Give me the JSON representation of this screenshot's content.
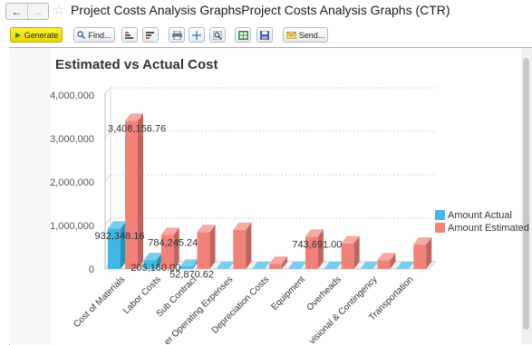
{
  "window": {
    "title": "Project Costs Analysis GraphsProject Costs Analysis Graphs (CTR)"
  },
  "toolbar": {
    "generate_label": "Generate",
    "find_label": "Find...",
    "send_label": "Send..."
  },
  "chart_data": {
    "type": "bar",
    "title": "Estimated vs Actual Cost",
    "categories": [
      "Cost of Materials",
      "Labor Costs",
      "Sub Contract",
      "er Operating Expenses",
      "Depreciation Costs",
      "Equipment",
      "Overheads",
      "visional & Contingency",
      "Transportation"
    ],
    "series": [
      {
        "name": "Amount Actual",
        "color": "#3fb8e8",
        "values": [
          932348.16,
          205180.0,
          52870.62,
          0,
          0,
          0,
          0,
          0,
          0
        ]
      },
      {
        "name": "Amount Estimated",
        "color": "#f28278",
        "values": [
          3408156.76,
          784245.24,
          850000,
          900000,
          120000,
          743691.0,
          590000,
          200000,
          560000
        ]
      }
    ],
    "data_labels": [
      {
        "series": 0,
        "index": 0,
        "text": "932,348.16"
      },
      {
        "series": 1,
        "index": 0,
        "text": "3,408,156.76"
      },
      {
        "series": 0,
        "index": 1,
        "text": "205,180.00"
      },
      {
        "series": 1,
        "index": 1,
        "text": "784,245.24"
      },
      {
        "series": 0,
        "index": 2,
        "text": "52,870.62"
      },
      {
        "series": 1,
        "index": 5,
        "text": "743,691.00"
      }
    ],
    "yticks": [
      "0",
      "1,000,000",
      "2,000,000",
      "3,000,000",
      "4,000,000"
    ],
    "ylim": [
      0,
      4000000
    ],
    "legend_position": "right",
    "grid": true
  }
}
